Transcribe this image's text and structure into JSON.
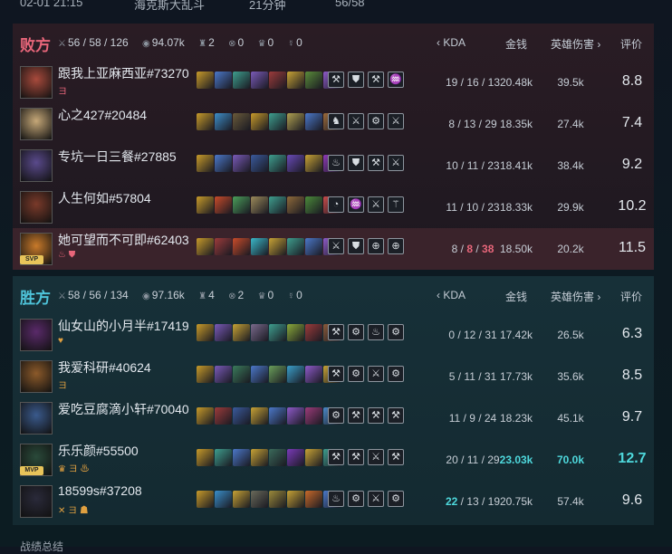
{
  "topbar": {
    "date": "02-01 21:15",
    "mode": "海克斯大乱斗",
    "duration": "21分钟",
    "count": "56/58"
  },
  "columns": {
    "kda": "KDA",
    "gold": "金钱",
    "damage": "英雄伤害",
    "score": "评价"
  },
  "colors": {
    "lose": "#e8667a",
    "win": "#4ec3d9",
    "highlight": "#4ed8dc"
  },
  "teams": [
    {
      "name": "败方",
      "stats": {
        "kda": "56 / 58 / 126",
        "gold": "94.07k",
        "towers": "2",
        "dragons": "0",
        "barons": "0",
        "heralds": "0"
      },
      "players": [
        {
          "name": "跟我上亚麻西亚#73270",
          "tags": "ヨ",
          "kda": "19 / 16 / 13",
          "gold": "20.48k",
          "damage": "39.5k",
          "score": "8.8",
          "avatar": "#a84a3c",
          "items": [
            "#c79a2a",
            "#4b78c9",
            "#3e9e8e",
            "#7a5ab8",
            "#9c3b3b",
            "#c7a235",
            "#5a8c3a",
            "#8e5ac9"
          ],
          "runes": [
            "⚒",
            "⛊",
            "⚒",
            "♒"
          ]
        },
        {
          "name": "心之427#20484",
          "tags": "",
          "kda": "8 / 13 / 29",
          "gold": "18.35k",
          "damage": "27.4k",
          "score": "7.4",
          "avatar": "#c6a878",
          "items": [
            "#c79a2a",
            "#3e8ec9",
            "#6a5a3a",
            "#c79a2a",
            "#3e9e8e",
            "#b0a050",
            "#4b78c9",
            "#9c6b3b"
          ],
          "runes": [
            "♞",
            "⚔",
            "⚙",
            "⚔"
          ]
        },
        {
          "name": "专坑一日三餐#27885",
          "tags": "",
          "kda": "10 / 11 / 23",
          "gold": "18.41k",
          "damage": "38.4k",
          "score": "9.2",
          "avatar": "#5a4a8c",
          "items": [
            "#c79a2a",
            "#4b78c9",
            "#7a5ab8",
            "#3a5a9c",
            "#3e9e8e",
            "#6a4ab8",
            "#c7a235",
            "#8e3ab8"
          ],
          "runes": [
            "♨",
            "⛊",
            "⚒",
            "⚔"
          ]
        },
        {
          "name": "人生何如#57804",
          "tags": "",
          "kda": "11 / 10 / 23",
          "gold": "18.33k",
          "damage": "29.9k",
          "score": "10.2",
          "avatar": "#7a3a2a",
          "items": [
            "#c79a2a",
            "#c94b2a",
            "#4b9e5a",
            "#9c8a5a",
            "#3e9e8e",
            "#8e6a3a",
            "#4b8a3a",
            "#c94b4b"
          ],
          "runes": [
            "◔",
            "♒",
            "⚔",
            "⚚"
          ]
        },
        {
          "name": "她可望而不可即#62403",
          "tags": "♨ ⛊",
          "badge": "SVP",
          "kda": "8 / 8 / 38",
          "gold": "18.50k",
          "damage": "20.2k",
          "score": "11.5",
          "avatar": "#c97a2a",
          "items": [
            "#c79a2a",
            "#9c3b3b",
            "#c94b2a",
            "#3ab8c9",
            "#c7a235",
            "#3e9e8e",
            "#4b78c9",
            "#8e5ac9"
          ],
          "runes": [
            "⚔",
            "⛊",
            "⊕",
            "⊕"
          ]
        }
      ]
    },
    {
      "name": "胜方",
      "stats": {
        "kda": "58 / 56 / 134",
        "gold": "97.16k",
        "towers": "4",
        "dragons": "2",
        "barons": "0",
        "heralds": "0"
      },
      "players": [
        {
          "name": "仙女山的小月半#17419",
          "tags": "♥",
          "kda": "0 / 12 / 31",
          "gold": "17.42k",
          "damage": "26.5k",
          "score": "6.3",
          "avatar": "#5a2a6a",
          "items": [
            "#c79a2a",
            "#7a5ab8",
            "#c7a235",
            "#7a6a8c",
            "#3e9e8e",
            "#8aaa3a",
            "#9c3b3b",
            "#8a5a3a"
          ],
          "runes": [
            "⚒",
            "⚙",
            "♨",
            "⚙"
          ]
        },
        {
          "name": "我爱科研#40624",
          "tags": "ヨ",
          "kda": "5 / 11 / 31",
          "gold": "17.73k",
          "damage": "35.6k",
          "score": "8.5",
          "avatar": "#8c5a2a",
          "items": [
            "#c79a2a",
            "#7a5ab8",
            "#3a7a5a",
            "#4b78c9",
            "#6a9e5a",
            "#3a9ec9",
            "#8e5ac9",
            "#c7a235"
          ],
          "runes": [
            "⚒",
            "⚙",
            "⚔",
            "⚙"
          ]
        },
        {
          "name": "爱吃豆腐滴小轩#70040",
          "tags": "",
          "kda": "11 / 9 / 24",
          "gold": "18.23k",
          "damage": "45.1k",
          "score": "9.7",
          "avatar": "#3a5a8c",
          "items": [
            "#c79a2a",
            "#9c3b3b",
            "#3a5a9c",
            "#c7a235",
            "#4b78c9",
            "#8e5ac9",
            "#9c3b7a",
            "#4b8ac9"
          ],
          "runes": [
            "⚙",
            "⚒",
            "⚒",
            "⚒"
          ]
        },
        {
          "name": "乐乐颜#55500",
          "tags": "♛ ヨ ♨",
          "badge": "MVP",
          "kda": "20 / 11 / 29",
          "gold": "23.03k",
          "damage": "70.0k",
          "score": "12.7",
          "avatar": "#2a4a3a",
          "items": [
            "#c79a2a",
            "#3e9e8e",
            "#4b78c9",
            "#c7a235",
            "#3a6a5a",
            "#7a3ab8",
            "#c7a235",
            "#3e9e8e"
          ],
          "runes": [
            "⚒",
            "⚒",
            "⚔",
            "⚒"
          ]
        },
        {
          "name": "18599s#37208",
          "tags": "✕ ヨ ☗",
          "kda": "22 / 13 / 19",
          "gold": "20.75k",
          "damage": "57.4k",
          "score": "9.6",
          "avatar": "#2a2a3a",
          "items": [
            "#c79a2a",
            "#3a8ec9",
            "#c7a235",
            "#6a6a5a",
            "#9c8a3a",
            "#c7a235",
            "#c96a2a",
            "#4b78c9"
          ],
          "runes": [
            "♨",
            "⚙",
            "⚔",
            "⚙"
          ]
        }
      ]
    }
  ],
  "bottom": "战绩总结"
}
